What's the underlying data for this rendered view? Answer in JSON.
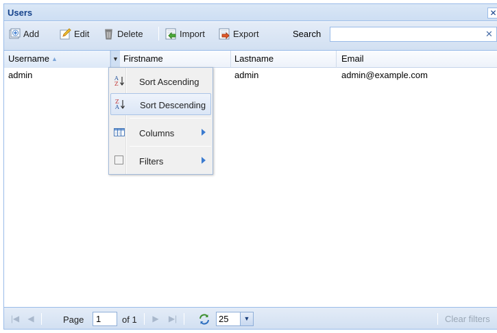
{
  "panel": {
    "title": "Users",
    "close_glyph": "✕"
  },
  "toolbar": {
    "add_label": "Add",
    "edit_label": "Edit",
    "delete_label": "Delete",
    "import_label": "Import",
    "export_label": "Export",
    "search_label": "Search",
    "search_value": "",
    "search_clear_glyph": "✕"
  },
  "grid": {
    "columns": [
      {
        "label": "Username",
        "sorted": "ascending"
      },
      {
        "label": "Firstname"
      },
      {
        "label": "Lastname"
      },
      {
        "label": "Email"
      }
    ],
    "sort_arrow": "▲",
    "trigger_glyph": "▼",
    "rows": [
      {
        "username": "admin",
        "firstname": "",
        "lastname": "admin",
        "email": "admin@example.com"
      }
    ]
  },
  "column_menu": {
    "items": [
      {
        "label": "Sort Ascending",
        "icon": "sort-ascending-icon"
      },
      {
        "label": "Sort Descending",
        "icon": "sort-descending-icon",
        "highlighted": true
      },
      {
        "label": "Columns",
        "icon": "columns-icon",
        "submenu": true
      },
      {
        "label": "Filters",
        "icon": "checkbox-icon",
        "submenu": true
      }
    ]
  },
  "paging": {
    "page_label": "Page",
    "page_value": "1",
    "of_label": "of 1",
    "page_size": "25",
    "clear_filters_label": "Clear filters"
  },
  "colors": {
    "border": "#99bbe8",
    "title_text": "#15428b",
    "menu_highlight": "#dbe6f6",
    "submenu_arrow": "#3b7bd0"
  }
}
